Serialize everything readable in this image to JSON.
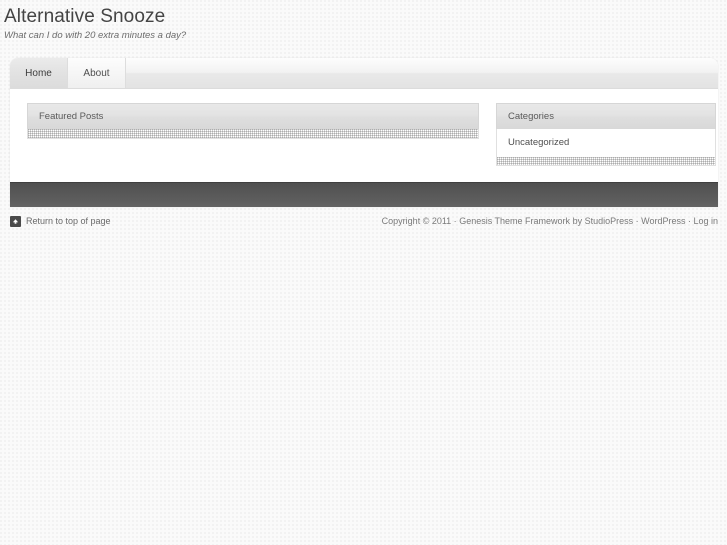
{
  "header": {
    "site_title": "Alternative Snooze",
    "tagline": "What can I do with 20 extra minutes a day?"
  },
  "nav": {
    "items": [
      {
        "label": "Home",
        "active": true
      },
      {
        "label": "About",
        "active": false
      }
    ]
  },
  "content": {
    "widgets": [
      {
        "title": "Featured Posts",
        "entries": []
      }
    ]
  },
  "sidebar": {
    "widgets": [
      {
        "title": "Categories",
        "entries": [
          "Uncategorized"
        ]
      }
    ]
  },
  "footer": {
    "back_to_top_label": "Return to top of page",
    "back_to_top_icon": "arrow-up-icon",
    "credits_prefix": "Copyright © 2011 · ",
    "credits_framework": "Genesis Theme Framework",
    "credits_by": " by ",
    "credits_studiopress": "StudioPress",
    "credits_sep1": " · ",
    "credits_wordpress": "WordPress",
    "credits_sep2": " · ",
    "credits_login": "Log in"
  },
  "colors": {
    "page_background": "#fafafa",
    "wrapper_background": "#ffffff",
    "footer_bar": "#545454",
    "text": "#444444",
    "muted_text": "#7a7a7a"
  }
}
